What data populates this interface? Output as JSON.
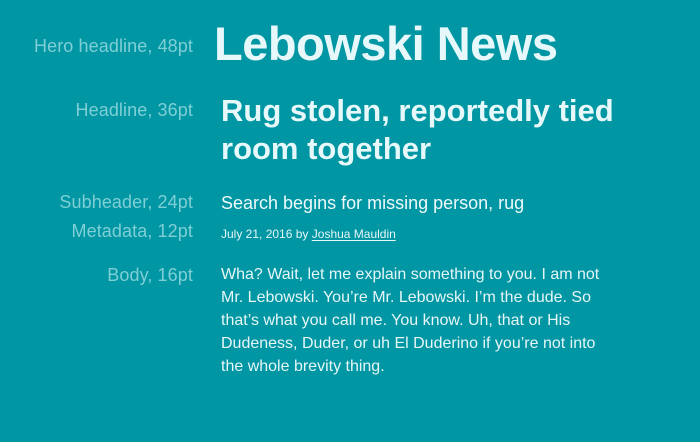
{
  "labels": {
    "hero": "Hero headline, 48pt",
    "headline": "Headline, 36pt",
    "subheader": "Subheader, 24pt",
    "metadata": "Metadata, 12pt",
    "body": "Body, 16pt"
  },
  "samples": {
    "hero": "Lebowski News",
    "headline": "Rug stolen, reportedly tied room together",
    "subheader": "Search begins for missing person, rug",
    "metadata_date": "July 21, 2016",
    "metadata_by": "by",
    "metadata_author": "Joshua Mauldin",
    "body": "Wha? Wait, let me explain something to you. I am not Mr. Lebowski. You’re Mr. Lebowski. I’m the dude. So that’s what you call me. You know. Uh, that or His Dudeness, Duder, or uh El Duderino if you’re not into the whole brevity thing."
  },
  "colors": {
    "background": "#0096a3",
    "label": "#7fcfd6",
    "text": "#e6f8fa"
  }
}
